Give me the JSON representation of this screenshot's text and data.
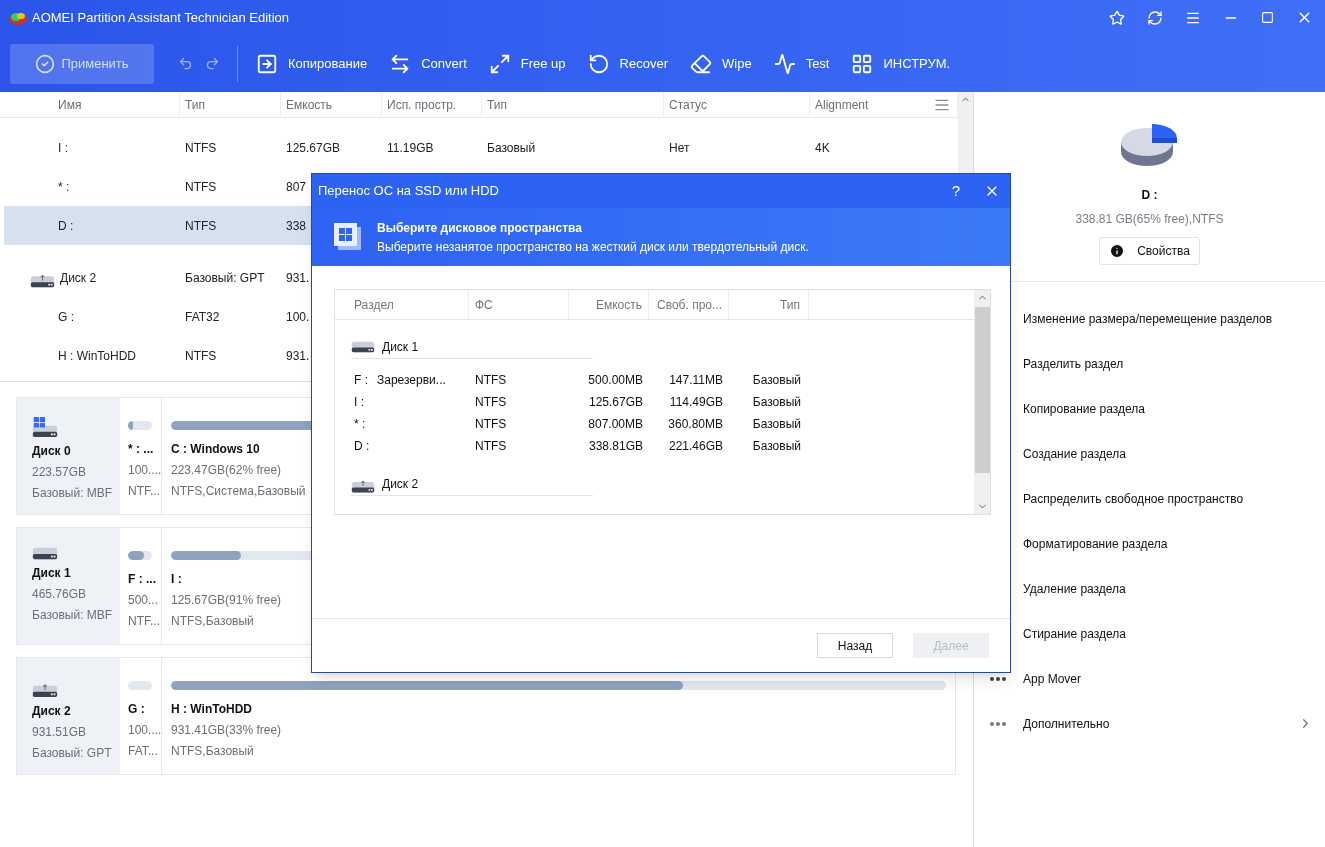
{
  "window": {
    "title": "AOMEI Partition Assistant Technician Edition"
  },
  "toolbar": {
    "apply": {
      "label": "Применить",
      "disabled": true
    },
    "tools": [
      {
        "label": "Копирование",
        "kind": "copy"
      },
      {
        "label": "Convert",
        "kind": "convert"
      },
      {
        "label": "Free up",
        "kind": "freeup"
      },
      {
        "label": "Recover",
        "kind": "recover"
      },
      {
        "label": "Wipe",
        "kind": "wipe"
      },
      {
        "label": "Test",
        "kind": "test"
      },
      {
        "label": "ИНСТРУМ.",
        "kind": "tools"
      }
    ]
  },
  "partition_table": {
    "columns": [
      "Имя",
      "Тип",
      "Емкость",
      "Исп. простр.",
      "Тип",
      "Статус",
      "Alignment"
    ],
    "rows": [
      {
        "kind": "partition",
        "selected": false,
        "cells": [
          "I :",
          "NTFS",
          "125.67GB",
          "11.19GB",
          "Базовый",
          "Нет",
          "4K"
        ]
      },
      {
        "kind": "partition",
        "selected": false,
        "cells": [
          "* :",
          "NTFS",
          "807"
        ]
      },
      {
        "kind": "partition",
        "selected": true,
        "cells": [
          "D :",
          "NTFS",
          "338"
        ]
      },
      {
        "kind": "disk",
        "selected": false,
        "cells": [
          "Диск 2",
          "Базовый: GPT",
          "931."
        ]
      },
      {
        "kind": "partition",
        "selected": false,
        "cells": [
          "G :",
          "FAT32",
          "100."
        ]
      },
      {
        "kind": "partition",
        "selected": false,
        "cells": [
          "H : WinToHDD",
          "NTFS",
          "931."
        ]
      }
    ]
  },
  "disk_map": [
    {
      "name": "Диск 0",
      "size": "223.57GB",
      "type": "Базовый: MBF",
      "kind": "system",
      "partitions": [
        {
          "name": "* : ...",
          "size": "100....",
          "info": "NTF...",
          "level": 0.2
        },
        {
          "name": "C : Windows 10",
          "size": "223.47GB(62% free)",
          "info": "NTFS,Система,Базовый",
          "level": 0.38
        }
      ]
    },
    {
      "name": "Диск 1",
      "size": "465.76GB",
      "type": "Базовый: MBF",
      "kind": "hdd",
      "partitions": [
        {
          "name": "F : ...",
          "size": "500...",
          "info": "NTF...",
          "level": 0.65
        },
        {
          "name": "I :",
          "size": "125.67GB(91% free)",
          "info": "NTFS,Базовый",
          "level": 0.09
        }
      ]
    },
    {
      "name": "Диск 2",
      "size": "931.51GB",
      "type": "Базовый: GPT",
      "kind": "usb",
      "partitions": [
        {
          "name": "G :",
          "size": "100....",
          "info": "FAT..."
        },
        {
          "name": "H : WinToHDD",
          "size": "931.41GB(33% free)",
          "info": "NTFS,Базовый",
          "level": 0.66
        }
      ]
    }
  ],
  "side_panel": {
    "selected_name": "D :",
    "selected_info": "338.81 GB(65% free),NTFS",
    "properties_button": "Свойства",
    "actions": [
      {
        "label": "Изменение размера/перемещение разделов",
        "kind": "plain"
      },
      {
        "label": "Разделить раздел",
        "kind": "plain"
      },
      {
        "label": "Копирование раздела",
        "kind": "plain"
      },
      {
        "label": "Создание раздела",
        "kind": "plain"
      },
      {
        "label": "Распределить свободное пространство",
        "kind": "plain"
      },
      {
        "label": "Форматирование раздела",
        "kind": "plain"
      },
      {
        "label": "Удаление раздела",
        "kind": "plain"
      },
      {
        "label": "Стирание раздела",
        "kind": "plain"
      },
      {
        "label": "App Mover",
        "kind": "dots"
      },
      {
        "label": "Дополнительно",
        "kind": "submenu"
      }
    ]
  },
  "dialog": {
    "title": "Перенос ОС на SSD или HDD",
    "help": "?",
    "heading": "Выберите дисковое пространства",
    "subtitle": "Выберите незанятое пространство на жесткий диск или твердотельный диск.",
    "columns": [
      "Раздел",
      "ФС",
      "Емкость",
      "Своб. про...",
      "Тип"
    ],
    "groups": [
      {
        "disk": "Диск 1",
        "kind": "hdd",
        "rows": [
          {
            "name": "F :",
            "label": "Зарезерви...",
            "fs": "NTFS",
            "capacity": "500.00MB",
            "free": "147.11MB",
            "type": "Базовый"
          },
          {
            "name": "I :",
            "fs": "NTFS",
            "capacity": "125.67GB",
            "free": "114.49GB",
            "type": "Базовый"
          },
          {
            "name": "* :",
            "fs": "NTFS",
            "capacity": "807.00MB",
            "free": "360.80MB",
            "type": "Базовый"
          },
          {
            "name": "D :",
            "fs": "NTFS",
            "capacity": "338.81GB",
            "free": "221.46GB",
            "type": "Базовый"
          }
        ]
      },
      {
        "disk": "Диск 2",
        "kind": "usb"
      }
    ],
    "buttons": [
      {
        "label": "Назад",
        "disabled": false
      },
      {
        "label": "Далее",
        "disabled": true
      }
    ]
  }
}
